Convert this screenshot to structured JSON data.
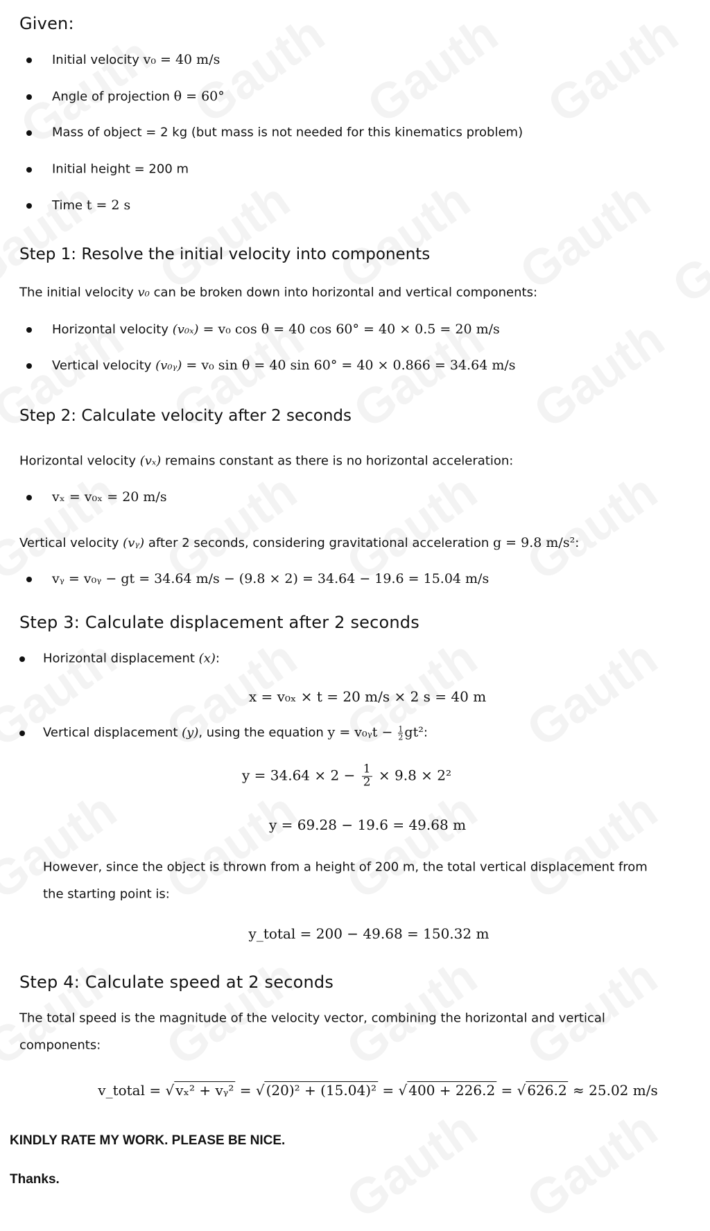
{
  "watermark_text": "Gauth",
  "given": {
    "heading": "Given:",
    "items": [
      {
        "label": "Initial velocity ",
        "math": "v₀ = 40 m/s"
      },
      {
        "label": "Angle of projection ",
        "math": "θ = 60°"
      },
      {
        "label": "Mass of object = 2 kg (but mass is not needed for this kinematics problem)",
        "math": ""
      },
      {
        "label": "Initial height = 200 m",
        "math": ""
      },
      {
        "label": "Time ",
        "math": "t = 2 s"
      }
    ]
  },
  "step1": {
    "heading": "Step 1: Resolve the initial velocity into components",
    "intro_a": "The initial velocity ",
    "intro_math": "v₀",
    "intro_b": " can be broken down into horizontal and vertical components:",
    "items": [
      {
        "label": "Horizontal velocity ",
        "sym": "(v₀ₓ)",
        "math": " = v₀ cos θ = 40 cos 60° = 40 × 0.5 = 20 m/s"
      },
      {
        "label": "Vertical velocity ",
        "sym": "(v₀ᵧ)",
        "math": " = v₀ sin θ = 40 sin 60° = 40 × 0.866 = 34.64 m/s"
      }
    ]
  },
  "step2": {
    "heading": "Step 2: Calculate velocity after 2 seconds",
    "horiz_a": "Horizontal velocity ",
    "horiz_sym": "(vₓ)",
    "horiz_b": " remains constant as there is no horizontal acceleration:",
    "horiz_eq": "vₓ = v₀ₓ = 20 m/s",
    "vert_a": "Vertical velocity ",
    "vert_sym": "(vᵧ)",
    "vert_b": " after 2 seconds, considering gravitational acceleration ",
    "vert_g": "g = 9.8 m/s²",
    "vert_c": ":",
    "vert_eq": "vᵧ = v₀ᵧ − gt = 34.64 m/s − (9.8 × 2) = 34.64 − 19.6 = 15.04 m/s"
  },
  "step3": {
    "heading": "Step 3: Calculate displacement after 2 seconds",
    "horiz_label": "Horizontal displacement ",
    "horiz_sym": "(x)",
    "horiz_colon": ":",
    "x_eq": "x = v₀ₓ × t = 20 m/s × 2 s = 40 m",
    "vert_label": "Vertical displacement ",
    "vert_sym": "(y)",
    "vert_mid": ", using the equation ",
    "vert_eq_a": "y = v₀ᵧt − ",
    "vert_eq_num": "1",
    "vert_eq_den": "2",
    "vert_eq_b": "gt²",
    "vert_colon": ":",
    "y_eq1_a": "y = 34.64 × 2 − ",
    "y_eq1_num": "1",
    "y_eq1_den": "2",
    "y_eq1_b": " × 9.8 × 2²",
    "y_eq2": "y = 69.28 − 19.6 = 49.68 m",
    "however_1": "However, since the object is thrown from a height of 200 m, the total vertical displacement from",
    "however_2": "the starting point is:",
    "ytotal_eq": "y_total = 200 − 49.68 = 150.32 m"
  },
  "step4": {
    "heading": "Step 4: Calculate speed at 2 seconds",
    "intro_1": "The total speed is the magnitude of the velocity vector, combining the horizontal and vertical",
    "intro_2": "components:",
    "eq_lhs": "v_total = ",
    "eq_r1": "vₓ² + vᵧ²",
    "eq_r2": "(20)² + (15.04)²",
    "eq_r3": "400 + 226.2",
    "eq_r4": "626.2",
    "eq_result": " ≈ 25.02 m/s",
    "eq_equals": " = "
  },
  "closing": {
    "request": "KINDLY RATE MY WORK. PLEASE BE NICE.",
    "thanks": "Thanks."
  }
}
